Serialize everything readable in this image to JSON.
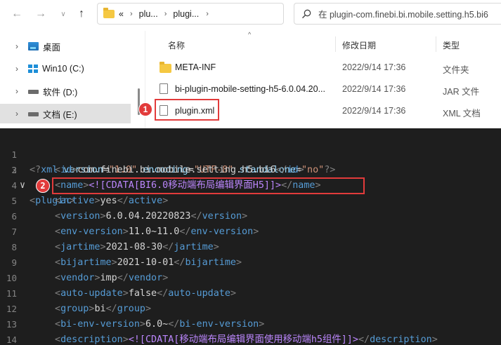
{
  "explorer": {
    "breadcrumb": [
      "«",
      "plu...",
      "plugi..."
    ],
    "search_placeholder": "在 plugin-com.finebi.bi.mobile.setting.h5.bi6",
    "nav_items": [
      {
        "label": "桌面",
        "icon": "desktop-icon"
      },
      {
        "label": "Win10 (C:)",
        "icon": "windows-drive-icon"
      },
      {
        "label": "软件 (D:)",
        "icon": "drive-icon"
      },
      {
        "label": "文档 (E:)",
        "icon": "drive-icon",
        "selected": true
      }
    ],
    "columns": {
      "name": "名称",
      "date": "修改日期",
      "type": "类型"
    },
    "files": [
      {
        "name": "META-INF",
        "date": "2022/9/14 17:36",
        "type": "文件夹",
        "icon": "folder-icon"
      },
      {
        "name": "bi-plugin-mobile-setting-h5-6.0.04.20...",
        "date": "2022/9/14 17:36",
        "type": "JAR 文件",
        "icon": "file-icon"
      },
      {
        "name": "plugin.xml",
        "date": "2022/9/14 17:36",
        "type": "XML 文档",
        "icon": "file-icon"
      }
    ]
  },
  "callouts": {
    "first": "1",
    "second": "2"
  },
  "accent_color": "#e23b3b",
  "editor": {
    "lines": [
      {
        "n": "1",
        "xml_decl": true,
        "version": "\"1.0\"",
        "encoding": "\"UTF-8\"",
        "standalone": "\"no\""
      },
      {
        "n": "2",
        "tag": "plugin"
      },
      {
        "n": "3",
        "tag": "id",
        "text": "com.finebi.bi.mobile.setting.h5.bi6"
      },
      {
        "n": "4",
        "tag": "name",
        "cdata": "<![CDATA[BI6.0移动端布局编辑界面H5]]>"
      },
      {
        "n": "5",
        "tag": "active",
        "text": "yes"
      },
      {
        "n": "6",
        "tag": "version",
        "text": "6.0.04.20220823"
      },
      {
        "n": "7",
        "tag": "env-version",
        "text": "11.0~11.0"
      },
      {
        "n": "8",
        "tag": "jartime",
        "text": "2021-08-30"
      },
      {
        "n": "9",
        "tag": "bijartime",
        "text": "2021-10-01"
      },
      {
        "n": "10",
        "tag": "vendor",
        "text": "imp"
      },
      {
        "n": "11",
        "tag": "auto-update",
        "text": "false"
      },
      {
        "n": "12",
        "tag": "group",
        "text": "bi"
      },
      {
        "n": "13",
        "tag": "bi-env-version",
        "text": "6.0~"
      },
      {
        "n": "14",
        "tag": "description",
        "cdata": "<![CDATA[移动端布局编辑界面使用移动端h5组件]]>"
      }
    ]
  }
}
